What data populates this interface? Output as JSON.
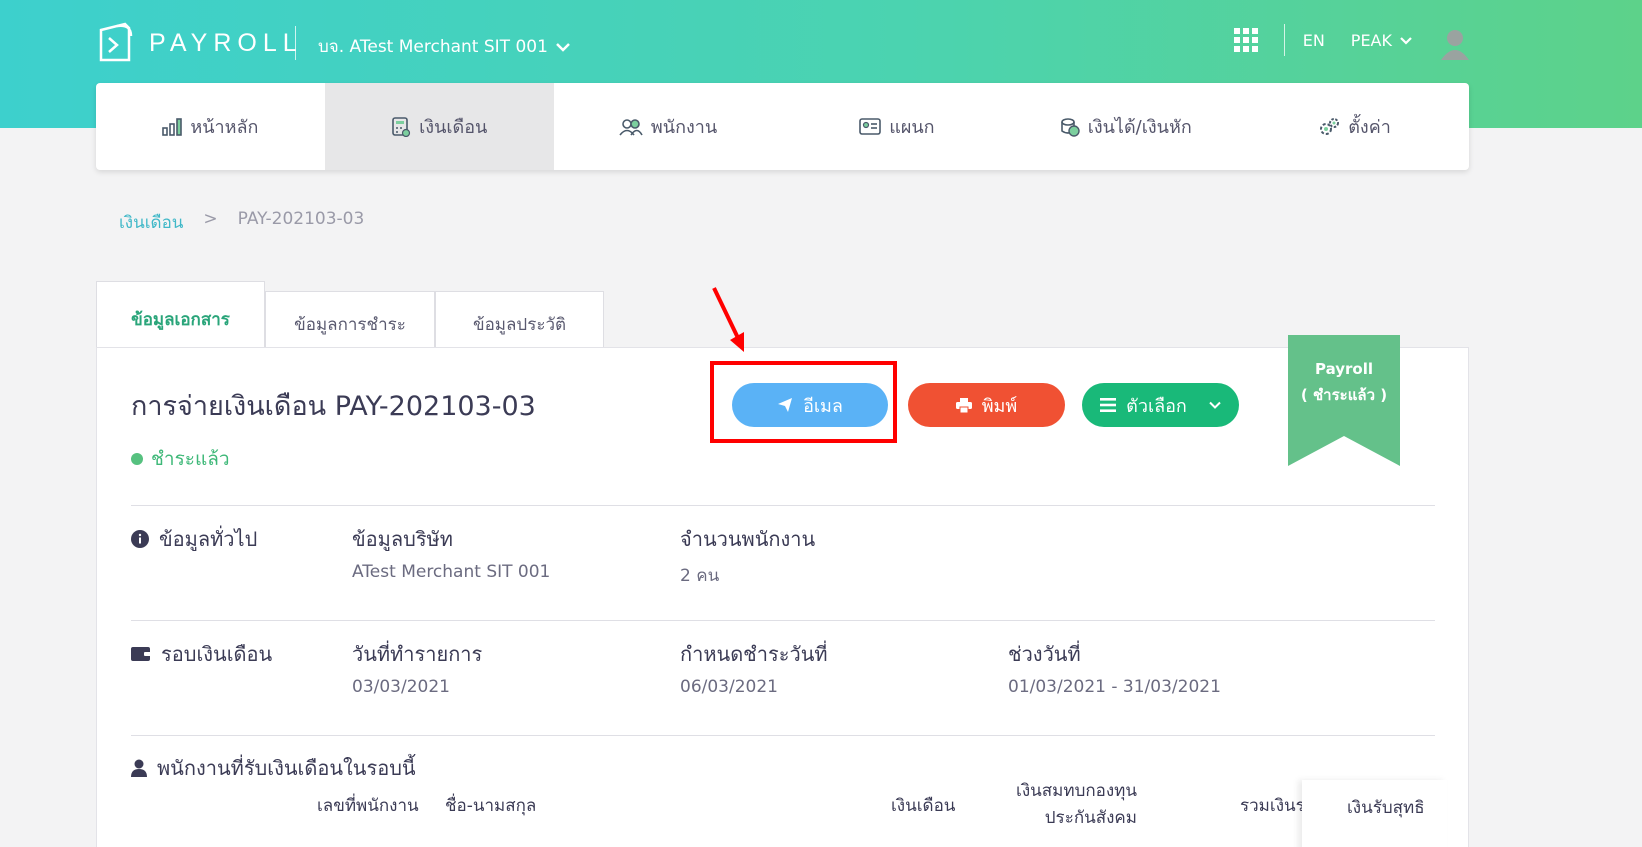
{
  "header": {
    "brand": "PAYROLL",
    "company": "บจ. ATest Merchant SIT 001",
    "lang": "EN",
    "user": "PEAK",
    "icons": [
      "apps-grid-icon",
      "chevron-down-icon",
      "avatar-icon"
    ]
  },
  "nav": {
    "items": [
      {
        "label": "หน้าหลัก",
        "icon": "chart-icon"
      },
      {
        "label": "เงินเดือน",
        "icon": "calculator-icon",
        "active": true
      },
      {
        "label": "พนักงาน",
        "icon": "users-icon"
      },
      {
        "label": "แผนก",
        "icon": "id-card-icon"
      },
      {
        "label": "เงินได้/เงินหัก",
        "icon": "coins-icon"
      },
      {
        "label": "ตั้งค่า",
        "icon": "gears-icon"
      }
    ]
  },
  "breadcrumb": {
    "link": "เงินเดือน",
    "separator": ">",
    "current": "PAY-202103-03"
  },
  "tabs": [
    "ข้อมูลเอกสาร",
    "ข้อมูลการชำระ",
    "ข้อมูลประวัติ"
  ],
  "doc": {
    "title": "การจ่ายเงินเดือน PAY-202103-03",
    "status": "ชำระแล้ว"
  },
  "buttons": {
    "email": "อีเมล",
    "print": "พิมพ์",
    "options": "ตัวเลือก"
  },
  "ribbon": {
    "line1": "Payroll",
    "line2": "( ชำระแล้ว )"
  },
  "general": {
    "heading": "ข้อมูลทั่วไป",
    "company_label": "ข้อมูลบริษัท",
    "company_value": "ATest Merchant SIT 001",
    "emp_label": "จำนวนพนักงาน",
    "emp_value": "2 คน"
  },
  "cycle": {
    "heading": "รอบเงินเดือน",
    "date_label": "วันที่ทำรายการ",
    "date_value": "03/03/2021",
    "due_label": "กำหนดชำระวันที่",
    "due_value": "06/03/2021",
    "range_label": "ช่วงวันที่",
    "range_value": "01/03/2021 - 31/03/2021"
  },
  "employees": {
    "heading": "พนักงานที่รับเงินเดือนในรอบนี้",
    "columns": [
      "เลขที่พนักงาน",
      "ชื่อ-นามสกุล",
      "เงินเดือน",
      "เงินสมทบกองทุน",
      "ประกันสังคม",
      "รวมเงินร",
      "เงินรับสุทธิ"
    ]
  },
  "colors": {
    "accent": "#19b979",
    "email": "#5ab2f6",
    "print": "#f05133",
    "link": "#40b8c8",
    "highlight": "#ff0000"
  }
}
